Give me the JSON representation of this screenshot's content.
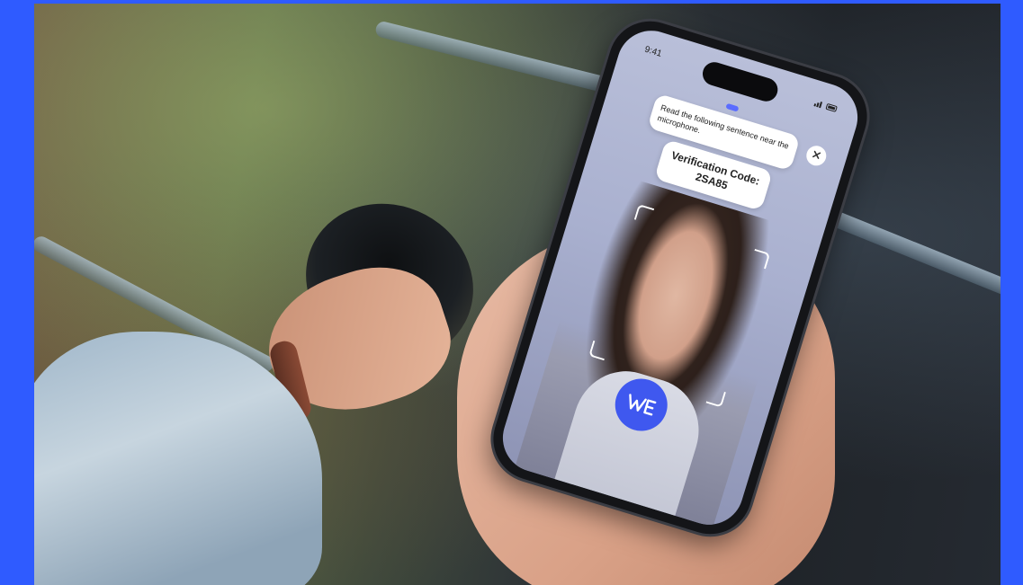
{
  "colors": {
    "border": "#2f5bff",
    "accent": "#3f58ef",
    "indicator": "#5a6cff"
  },
  "phone": {
    "status_time": "9:41",
    "instruction_text": "Read the following sentence near the microphone.",
    "code_label": "Verification Code:",
    "code_value": "2SA85",
    "close_icon": "close-icon",
    "logo_icon": "we-logo-icon"
  }
}
